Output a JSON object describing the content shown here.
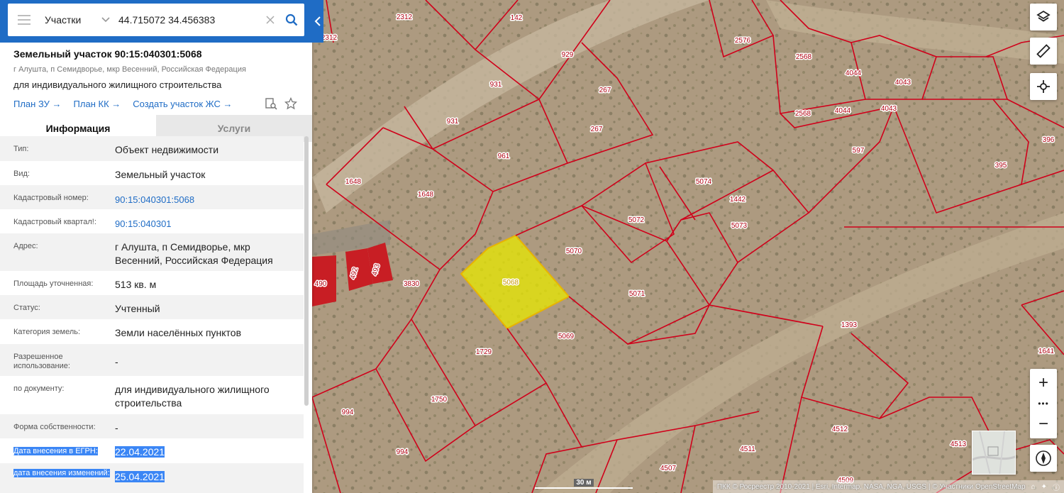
{
  "search": {
    "layer": "Участки",
    "query": "44.715072 34.456383"
  },
  "object": {
    "title": "Земельный участок 90:15:040301:5068",
    "address": "г Алушта, п Семидворье, мкр Весенний, Российская Федерация",
    "purpose": "для индивидуального жилищного строительства",
    "links": [
      "План ЗУ",
      "План КК",
      "Создать участок ЖС"
    ]
  },
  "tabs": [
    "Информация",
    "Услуги"
  ],
  "attributes": [
    {
      "key": "Тип:",
      "value": "Объект недвижимости"
    },
    {
      "key": "Вид:",
      "value": "Земельный участок"
    },
    {
      "key": "Кадастровый номер:",
      "value": "90:15:040301:5068",
      "link": true
    },
    {
      "key": "Кадастровый квартал!:",
      "value": "90:15:040301",
      "link": true
    },
    {
      "key": "Адрес:",
      "value": "г Алушта, п Семидворье, мкр Весенний, Российская Федерация"
    },
    {
      "key": "Площадь уточненная:",
      "value": "513 кв. м"
    },
    {
      "key": "Статус:",
      "value": "Учтенный"
    },
    {
      "key": "Категория земель:",
      "value": "Земли населённых пунктов"
    },
    {
      "key": "Разрешенное использование:",
      "value": "-"
    },
    {
      "key": "по документу:",
      "value": "для индивидуального жилищного строительства"
    },
    {
      "key": "Форма собственности:",
      "value": "-"
    },
    {
      "key": "Дата внесения в ЕГРН:",
      "value": "22.04.2021",
      "highlight": true
    },
    {
      "key": "дата внесения изменений:",
      "value": "25.04.2021",
      "highlight": true
    }
  ],
  "map": {
    "selected_parcel": "5068",
    "parcel_labels": [
      "2312",
      "2312",
      "142",
      "2576",
      "2568",
      "4044",
      "4043",
      "929",
      "931",
      "267",
      "931",
      "267",
      "2568",
      "4044",
      "4043",
      "597",
      "396",
      "395",
      "961",
      "1648",
      "1648",
      "5074",
      "1442",
      "5073",
      "5072",
      "5070",
      "5068",
      "3830",
      "5071",
      "490",
      "492",
      "493",
      "1393",
      "1729",
      "5069",
      "1641",
      "994",
      "1750",
      "994",
      "4512",
      "4511",
      "4513",
      "4507",
      "4509"
    ],
    "scale": "30 м",
    "attribution": "ПКК © Росреестр 2010-2021 | Esri, Intermap, NASA, NGA, USGS | © Участники OpenStreetMap",
    "colors": {
      "boundary": "#d0001a",
      "selected_fill": "#e8e800",
      "building": "#c81e24",
      "accent": "#1f6cc5"
    }
  }
}
